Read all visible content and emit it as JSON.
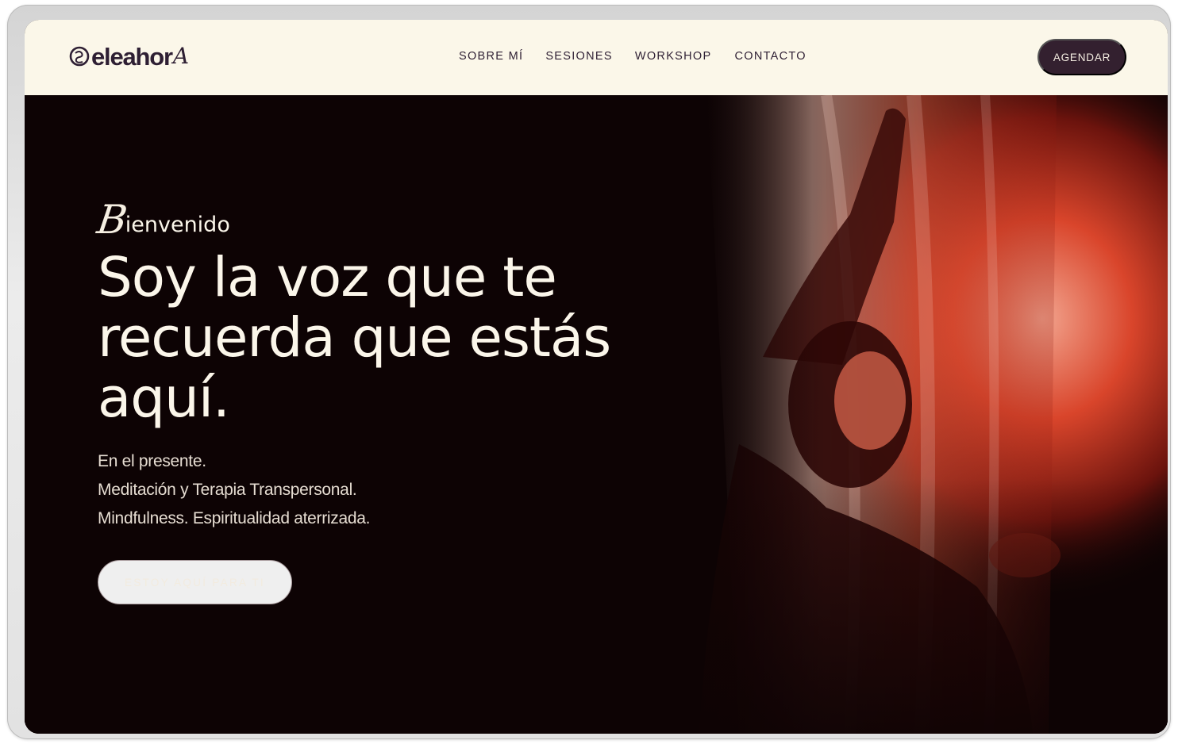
{
  "brand": {
    "logo_text": "eleahor",
    "logo_tail": "A",
    "accent_color": "#33202f",
    "header_bg": "#fbf7e9",
    "hero_bg": "#0d0304"
  },
  "nav": {
    "items": [
      {
        "label": "SOBRE MÍ"
      },
      {
        "label": "SESIONES"
      },
      {
        "label": "WORKSHOP"
      },
      {
        "label": "CONTACTO"
      }
    ],
    "cta_label": "AGENDAR"
  },
  "hero": {
    "welcome_cap": "B",
    "welcome_rest": "ienvenido",
    "headline_lines": [
      "Soy la voz que te",
      "recuerda que estás",
      "aquí."
    ],
    "sub_lines": [
      "En el presente.",
      "Meditación y Terapia Transpersonal.",
      "Mindfulness. Espiritualidad aterrizada."
    ],
    "cta_label": "ESTOY AQUÍ PARA TI"
  }
}
